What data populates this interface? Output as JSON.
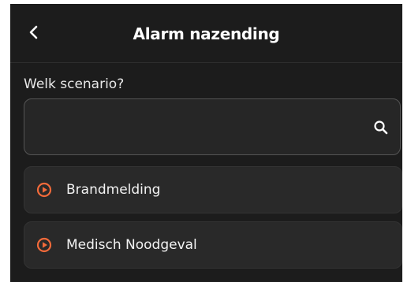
{
  "header": {
    "title": "Alarm nazending",
    "back_icon": "chevron-left-icon"
  },
  "scenario": {
    "label": "Welk scenario?",
    "search_value": "",
    "search_icon": "search-icon"
  },
  "items": [
    {
      "label": "Brandmelding",
      "icon": "play-circle-icon"
    },
    {
      "label": "Medisch Noodgeval",
      "icon": "play-circle-icon"
    }
  ],
  "colors": {
    "background": "#1c1c1c",
    "card": "#292929",
    "accent": "#f26a3a",
    "text": "#ffffff"
  }
}
